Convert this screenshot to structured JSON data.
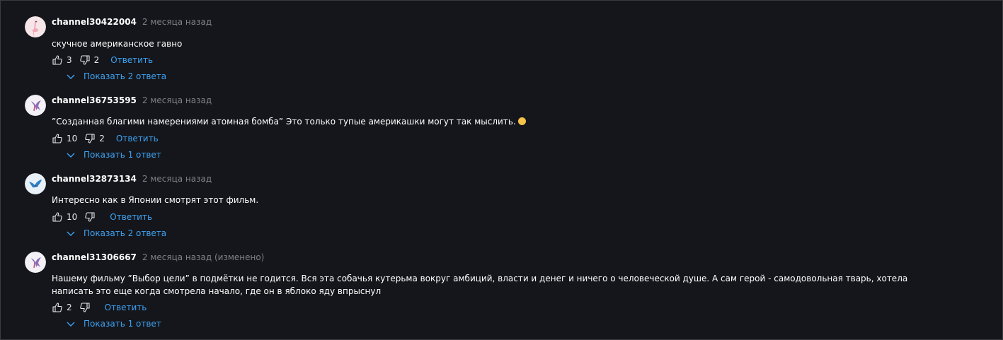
{
  "comments": [
    {
      "author": "channel30422004",
      "time": "2 месяца назад",
      "text": "скучное американское гавно",
      "likes": "3",
      "dislikes": "2",
      "reply_label": "Ответить",
      "show_replies": "Показать 2 ответа",
      "avatar": "pink-flamingo-avatar"
    },
    {
      "author": "channel36753595",
      "time": "2 месяца назад",
      "text": "”Созданная благими намерениями атомная бомба” Это только тупые америкашки могут так мыслить.",
      "emoji": "rolling-on-floor-laughing-emoji",
      "likes": "10",
      "dislikes": "2",
      "reply_label": "Ответить",
      "show_replies": "Показать 1 ответ",
      "avatar": "hummingbird-avatar"
    },
    {
      "author": "channel32873134",
      "time": "2 месяца назад",
      "text": "Интересно как в Японии смотрят этот фильм.",
      "likes": "10",
      "dislikes": "",
      "reply_label": "Ответить",
      "show_replies": "Показать 2 ответа",
      "avatar": "blue-bird-avatar"
    },
    {
      "author": "channel31306667",
      "time": "2 месяца назад (изменено)",
      "text": "Нашему фильму ”Выбор цели” в подмётки не годится. Вся эта собачья кутерьма вокруг амбиций, власти и денег и ничего о человеческой душе. А сам герой - самодовольная тварь, хотела написать это еще когда смотрела начало, где он в яблоко яду впрыснул",
      "likes": "2",
      "dislikes": "",
      "reply_label": "Ответить",
      "show_replies": "Показать 1 ответ",
      "avatar": "hummingbird-avatar"
    }
  ],
  "colors": {
    "background": "#15161b",
    "link": "#3da3f5",
    "muted": "#7f8189",
    "text": "#ffffff"
  }
}
